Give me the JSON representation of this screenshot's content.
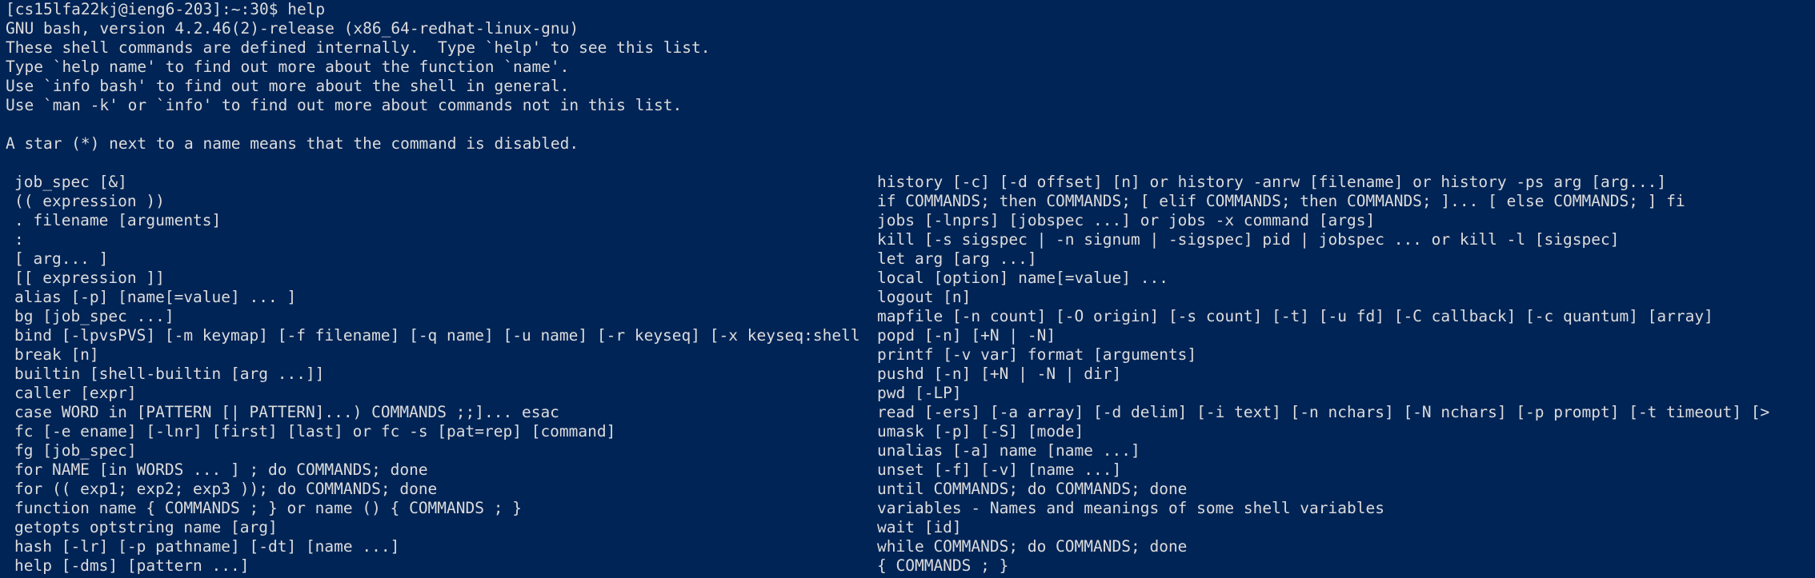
{
  "terminal": {
    "prompt_line": "[cs15lfa22kj@ieng6-203]:~:30$ help",
    "header_lines": [
      "GNU bash, version 4.2.46(2)-release (x86_64-redhat-linux-gnu)",
      "These shell commands are defined internally.  Type `help' to see this list.",
      "Type `help name' to find out more about the function `name'.",
      "Use `info bash' to find out more about the shell in general.",
      "Use `man -k' or `info' to find out more about commands not in this list.",
      "",
      "A star (*) next to a name means that the command is disabled."
    ],
    "left_commands": [
      "job_spec [&]",
      "(( expression ))",
      ". filename [arguments]",
      ":",
      "[ arg... ]",
      "[[ expression ]]",
      "alias [-p] [name[=value] ... ]",
      "bg [job_spec ...]",
      "bind [-lpvsPVS] [-m keymap] [-f filename] [-q name] [-u name] [-r keyseq] [-x keyseq:shell-comm>",
      "break [n]",
      "builtin [shell-builtin [arg ...]]",
      "caller [expr]",
      "case WORD in [PATTERN [| PATTERN]...) COMMANDS ;;]... esac",
      "fc [-e ename] [-lnr] [first] [last] or fc -s [pat=rep] [command]",
      "fg [job_spec]",
      "for NAME [in WORDS ... ] ; do COMMANDS; done",
      "for (( exp1; exp2; exp3 )); do COMMANDS; done",
      "function name { COMMANDS ; } or name () { COMMANDS ; }",
      "getopts optstring name [arg]",
      "hash [-lr] [-p pathname] [-dt] [name ...]",
      "help [-dms] [pattern ...]"
    ],
    "right_commands": [
      "history [-c] [-d offset] [n] or history -anrw [filename] or history -ps arg [arg...]",
      "if COMMANDS; then COMMANDS; [ elif COMMANDS; then COMMANDS; ]... [ else COMMANDS; ] fi",
      "jobs [-lnprs] [jobspec ...] or jobs -x command [args]",
      "kill [-s sigspec | -n signum | -sigspec] pid | jobspec ... or kill -l [sigspec]",
      "let arg [arg ...]",
      "local [option] name[=value] ...",
      "logout [n]",
      "mapfile [-n count] [-O origin] [-s count] [-t] [-u fd] [-C callback] [-c quantum] [array]",
      "popd [-n] [+N | -N]",
      "printf [-v var] format [arguments]",
      "pushd [-n] [+N | -N | dir]",
      "pwd [-LP]",
      "read [-ers] [-a array] [-d delim] [-i text] [-n nchars] [-N nchars] [-p prompt] [-t timeout] [>",
      "umask [-p] [-S] [mode]",
      "unalias [-a] name [name ...]",
      "unset [-f] [-v] [name ...]",
      "until COMMANDS; do COMMANDS; done",
      "variables - Names and meanings of some shell variables",
      "wait [id]",
      "while COMMANDS; do COMMANDS; done",
      "{ COMMANDS ; }"
    ],
    "colors": {
      "background": "#012456",
      "foreground": "#dcdcdc"
    }
  }
}
